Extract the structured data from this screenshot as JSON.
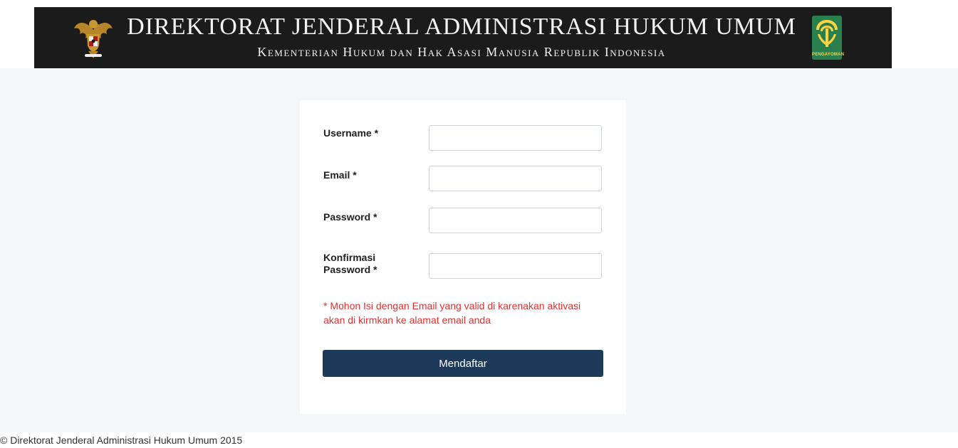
{
  "header": {
    "title": "DIREKTORAT JENDERAL ADMINISTRASI HUKUM UMUM",
    "subtitle": "Kementerian Hukum dan Hak Asasi Manusia Republik Indonesia",
    "left_emblem_icon": "garuda-pancasila-icon",
    "right_logo_icon": "pengayoman-icon",
    "right_logo_text": "PENGAYOMAN"
  },
  "form": {
    "username_label": "Username *",
    "username_value": "",
    "email_label": "Email *",
    "email_value": "",
    "password_label": "Password *",
    "password_value": "",
    "confirm_password_label_1": "Konfirmasi",
    "confirm_password_label_2": "Password *",
    "confirm_password_value": "",
    "notice": "* Mohon Isi dengan Email yang valid di karenakan aktivasi akan di kirmkan ke alamat email anda",
    "submit_label": "Mendaftar"
  },
  "footer": {
    "copyright": "© Direktorat Jenderal Administrasi Hukum Umum 2015"
  },
  "colors": {
    "header_bg": "#1b1b1b",
    "button_bg": "#1e3a5a",
    "notice_text": "#e83030",
    "page_bg": "#f5f6f8"
  }
}
